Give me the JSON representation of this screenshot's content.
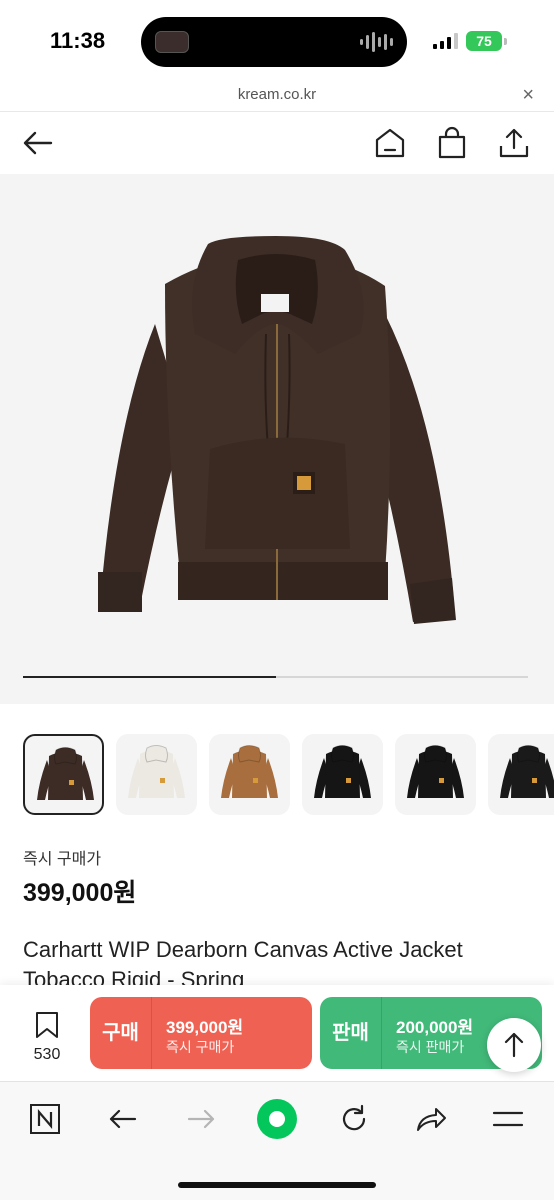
{
  "status_bar": {
    "time": "11:38",
    "battery": "75"
  },
  "browser": {
    "url": "kream.co.kr",
    "close_label": "×"
  },
  "header": {
    "icons": [
      "back-arrow-icon",
      "home-icon",
      "shopping-bag-icon",
      "share-icon"
    ]
  },
  "gallery": {
    "position_fraction": 0.5
  },
  "thumbnails": [
    {
      "color_name": "tobacco",
      "color": "#3d2c26",
      "selected": true
    },
    {
      "color_name": "white",
      "color": "#ece9e3",
      "selected": false
    },
    {
      "color_name": "hamilton-brown",
      "color": "#a86e3e",
      "selected": false
    },
    {
      "color_name": "black",
      "color": "#151515",
      "selected": false
    },
    {
      "color_name": "black",
      "color": "#151515",
      "selected": false
    },
    {
      "color_name": "black",
      "color": "#1a1a1a",
      "selected": false
    }
  ],
  "product": {
    "instant_price_label": "즉시 구매가",
    "instant_price": "399,000원",
    "title": "Carhartt WIP Dearborn Canvas Active Jacket Tobacco Rigid - Spring"
  },
  "action_bar": {
    "wish_count": "530",
    "buy": {
      "label": "구매",
      "price": "399,000원",
      "sub": "즉시 구매가"
    },
    "sell": {
      "label": "판매",
      "price": "200,000원",
      "sub": "즉시 판매가"
    }
  },
  "toolbar": {
    "icons": [
      "naver-n-icon",
      "back-icon",
      "forward-icon",
      "home-green-icon",
      "reload-icon",
      "share-icon",
      "menu-icon"
    ]
  },
  "colors": {
    "buy": "#ef6253",
    "sell": "#41b979",
    "naver_green": "#03c75a",
    "battery": "#34c759"
  }
}
